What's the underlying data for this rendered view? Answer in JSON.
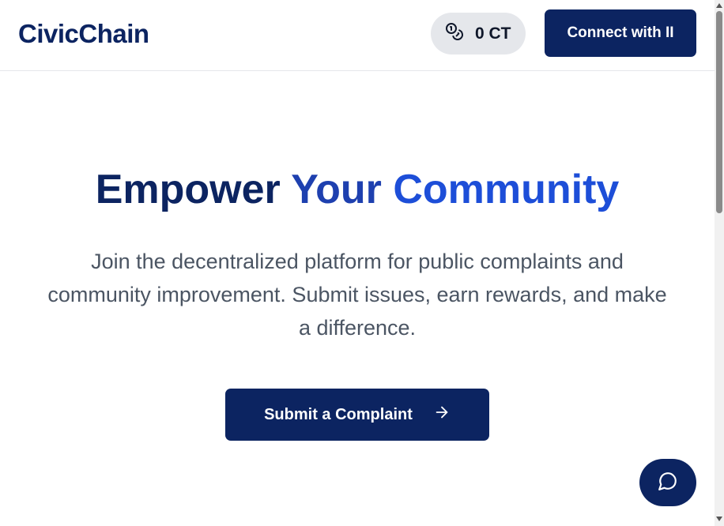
{
  "header": {
    "brand": "CivicChain",
    "token_balance": "0 CT",
    "token_icon": "coins-icon",
    "connect_label": "Connect with II"
  },
  "hero": {
    "title_part1": "Empower",
    "title_part2": "Your",
    "title_part3": "Community",
    "subtitle": "Join the decentralized platform for public complaints and community improvement. Submit issues, earn rewards, and make a difference.",
    "cta_label": "Submit a Complaint",
    "cta_icon": "arrow-right-icon"
  },
  "chat": {
    "icon": "chat-bubble-icon"
  },
  "colors": {
    "primary": "#0c2461",
    "accent": "#1d4ed8",
    "muted_text": "#4b5563",
    "pill_bg": "#e5e7eb"
  }
}
